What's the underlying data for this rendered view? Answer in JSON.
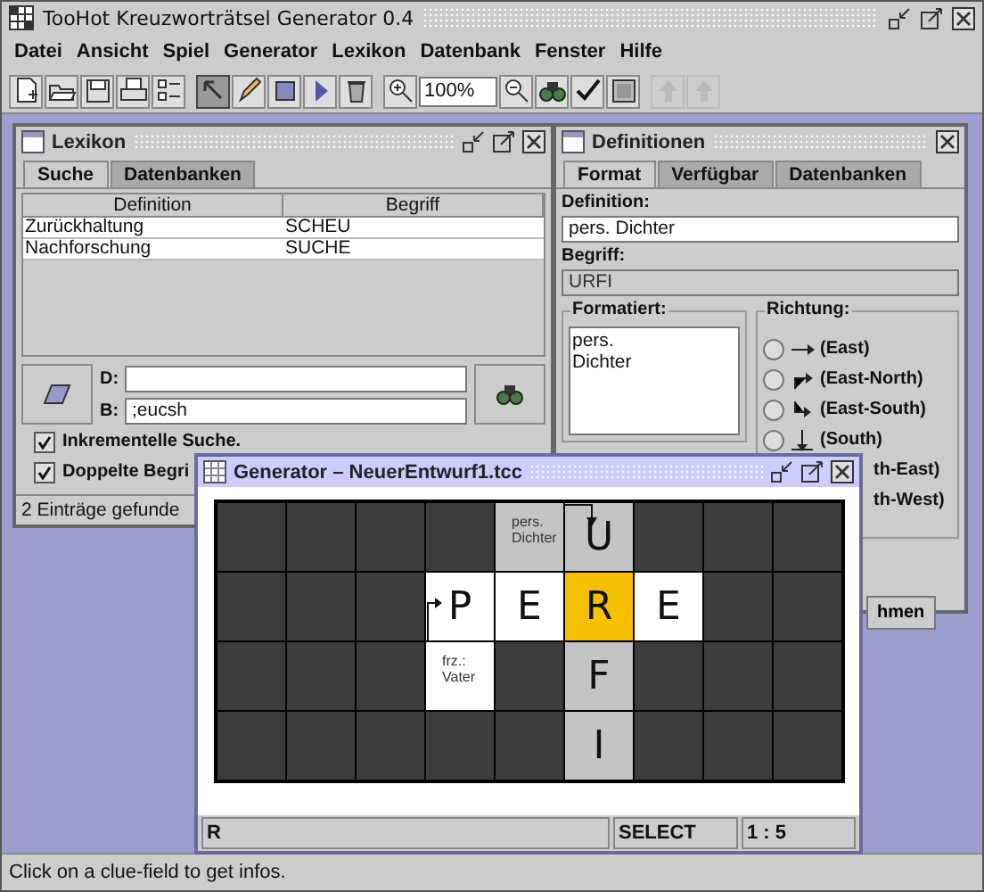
{
  "window": {
    "title": "TooHot Kreuzworträtsel Generator 0.4"
  },
  "menu": [
    "Datei",
    "Ansicht",
    "Spiel",
    "Generator",
    "Lexikon",
    "Datenbank",
    "Fenster",
    "Hilfe"
  ],
  "toolbar": {
    "groups": [
      [
        {
          "kind": "new",
          "selected": false,
          "disabled": false
        },
        {
          "kind": "open",
          "selected": false,
          "disabled": false
        },
        {
          "kind": "save",
          "selected": false,
          "disabled": false
        },
        {
          "kind": "print",
          "selected": false,
          "disabled": false
        },
        {
          "kind": "list",
          "selected": false,
          "disabled": false
        }
      ],
      [
        {
          "kind": "pointer",
          "selected": true,
          "disabled": false
        },
        {
          "kind": "pencil",
          "selected": false,
          "disabled": false
        },
        {
          "kind": "square",
          "selected": false,
          "disabled": false
        },
        {
          "kind": "play",
          "selected": false,
          "disabled": false
        },
        {
          "kind": "trash",
          "selected": false,
          "disabled": false
        }
      ],
      [
        {
          "kind": "zoom-in",
          "selected": false,
          "disabled": false
        },
        {
          "kind": "zoom-field",
          "value": "100%"
        },
        {
          "kind": "zoom-out",
          "selected": false,
          "disabled": false
        },
        {
          "kind": "binoculars",
          "selected": false,
          "disabled": false
        },
        {
          "kind": "check",
          "selected": false,
          "disabled": false
        },
        {
          "kind": "image",
          "selected": false,
          "disabled": false
        }
      ],
      [
        {
          "kind": "up",
          "disabled": true
        },
        {
          "kind": "up",
          "disabled": true
        }
      ]
    ]
  },
  "lexikon": {
    "title": "Lexikon",
    "active": false,
    "tabs": [
      {
        "label": "Suche",
        "selected": true
      },
      {
        "label": "Datenbanken",
        "selected": false
      }
    ],
    "columns": [
      "Definition",
      "Begriff"
    ],
    "rows": [
      [
        "Zurückhaltung",
        "SCHEU"
      ],
      [
        "Nachforschung",
        "SUCHE"
      ]
    ],
    "fields": [
      {
        "label": "D:"
      },
      {
        "label": "B:",
        "value": ";eucsh"
      }
    ],
    "checkboxes": [
      {
        "label": "Inkrementelle Suche.",
        "checked": true
      },
      {
        "label": "Doppelte Begri",
        "checked": true
      }
    ],
    "status": "2 Einträge gefunde"
  },
  "definitionen": {
    "title": "Definitionen",
    "active": false,
    "tabs": [
      {
        "label": "Format",
        "selected": true
      },
      {
        "label": "Verfügbar",
        "selected": false
      },
      {
        "label": "Datenbanken",
        "selected": false
      }
    ],
    "definition_label": "Definition:",
    "definition_value": "pers. Dichter",
    "begriff_label": "Begriff:",
    "begriff_value": "URFI",
    "formatiert_label": "Formatiert:",
    "formatiert_value": "pers.\nDichter",
    "richtung_label": "Richtung:",
    "directions": [
      {
        "kind": "full",
        "arrow": {
          "kind": "east"
        },
        "label": "(East)",
        "selected": false
      },
      {
        "kind": "full",
        "arrow": {
          "kind": "east-north"
        },
        "label": "(East-North)",
        "selected": false
      },
      {
        "kind": "full",
        "arrow": {
          "kind": "east-south"
        },
        "label": "(East-South)",
        "selected": false
      },
      {
        "kind": "full",
        "arrow": {
          "kind": "south"
        },
        "label": "(South)",
        "selected": false
      },
      {
        "kind": "partial",
        "label": "th-East)"
      },
      {
        "kind": "partial",
        "label": "th-West)"
      }
    ],
    "apply_button": "hmen"
  },
  "generator": {
    "title": "Generator – NeuerEntwurf1.tcc",
    "active": true,
    "grid": [
      [
        {
          "kind": "block"
        },
        {
          "kind": "block"
        },
        {
          "kind": "block"
        },
        {
          "kind": "block"
        },
        {
          "kind": "clue",
          "text": "pers. Dichter",
          "highlighted": true
        },
        {
          "kind": "letter",
          "letter": "U",
          "highlighted": true,
          "selected": false,
          "arrow": {
            "kind": "east-south"
          }
        },
        {
          "kind": "block"
        },
        {
          "kind": "block"
        },
        {
          "kind": "block"
        }
      ],
      [
        {
          "kind": "block"
        },
        {
          "kind": "block"
        },
        {
          "kind": "block"
        },
        {
          "kind": "letter",
          "letter": "P",
          "highlighted": false,
          "selected": false,
          "arrow": {
            "kind": "north-east"
          }
        },
        {
          "kind": "letter",
          "letter": "E",
          "highlighted": false,
          "selected": false
        },
        {
          "kind": "letter",
          "letter": "R",
          "selected": true
        },
        {
          "kind": "letter",
          "letter": "E",
          "highlighted": false,
          "selected": false
        },
        {
          "kind": "block"
        },
        {
          "kind": "block"
        }
      ],
      [
        {
          "kind": "block"
        },
        {
          "kind": "block"
        },
        {
          "kind": "block"
        },
        {
          "kind": "clue",
          "text": "frz.: Vater",
          "highlighted": false
        },
        {
          "kind": "block"
        },
        {
          "kind": "letter",
          "letter": "F",
          "highlighted": true,
          "selected": false
        },
        {
          "kind": "block"
        },
        {
          "kind": "block"
        },
        {
          "kind": "block"
        }
      ],
      [
        {
          "kind": "block"
        },
        {
          "kind": "block"
        },
        {
          "kind": "block"
        },
        {
          "kind": "block"
        },
        {
          "kind": "block"
        },
        {
          "kind": "letter",
          "letter": "I",
          "highlighted": true,
          "selected": false
        },
        {
          "kind": "block"
        },
        {
          "kind": "block"
        },
        {
          "kind": "block"
        }
      ]
    ],
    "status": [
      "R",
      "SELECT",
      "1 : 5"
    ]
  },
  "status_bar": "Click on a clue-field to get infos."
}
